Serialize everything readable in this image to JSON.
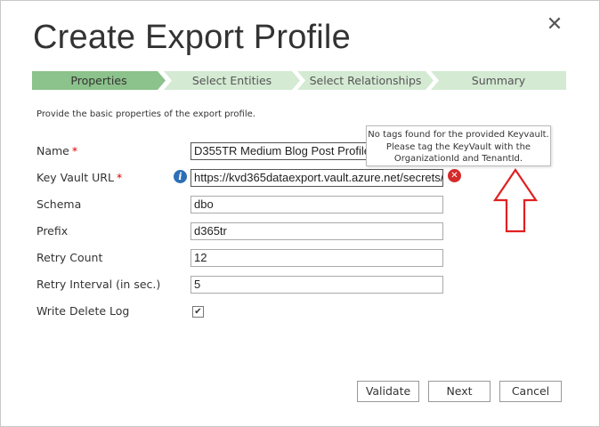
{
  "dialog": {
    "title": "Create Export Profile",
    "close_glyph": "✕"
  },
  "steps": [
    {
      "label": "Properties",
      "state": "active"
    },
    {
      "label": "Select Entities",
      "state": "inactive"
    },
    {
      "label": "Select Relationships",
      "state": "inactive"
    },
    {
      "label": "Summary",
      "state": "inactive"
    }
  ],
  "form": {
    "description": "Provide the basic properties of the export profile.",
    "required_marker": "*",
    "name": {
      "label": "Name",
      "value": "D355TR Medium Blog Post Profile"
    },
    "keyvault": {
      "label": "Key Vault URL",
      "value": "https://kvd365dataexport.vault.azure.net/secrets/"
    },
    "schema": {
      "label": "Schema",
      "value": "dbo"
    },
    "prefix": {
      "label": "Prefix",
      "value": "d365tr"
    },
    "retry_count": {
      "label": "Retry Count",
      "value": "12"
    },
    "retry_interval": {
      "label": "Retry Interval (in sec.)",
      "value": "5"
    },
    "write_delete_log": {
      "label": "Write Delete Log",
      "checked": true,
      "glyph": "✔"
    }
  },
  "tooltip": {
    "lines": [
      "No tags found for the provided Keyvault.",
      "Please tag the KeyVault with the",
      "OrganizationId and TenantId."
    ]
  },
  "icons": {
    "info": "i",
    "error": "✕"
  },
  "colors": {
    "step_active": "#8cc28b",
    "step_inactive": "#d4ead3",
    "error": "#d42a2a",
    "info": "#2c6fb5",
    "annotation_arrow": "#e02020"
  },
  "buttons": {
    "validate": "Validate",
    "next": "Next",
    "cancel": "Cancel"
  }
}
